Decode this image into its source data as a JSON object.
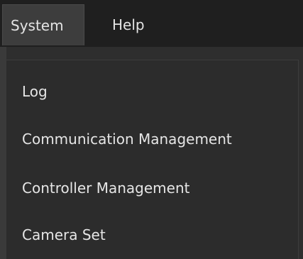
{
  "menubar": {
    "items": [
      {
        "label": "System",
        "state": "active"
      },
      {
        "label": "Help"
      }
    ]
  },
  "dropdown": {
    "parent": "System",
    "items": [
      {
        "label": "Log"
      },
      {
        "label": "Communication Management"
      },
      {
        "label": "Controller Management"
      },
      {
        "label": "Camera Set"
      }
    ]
  }
}
